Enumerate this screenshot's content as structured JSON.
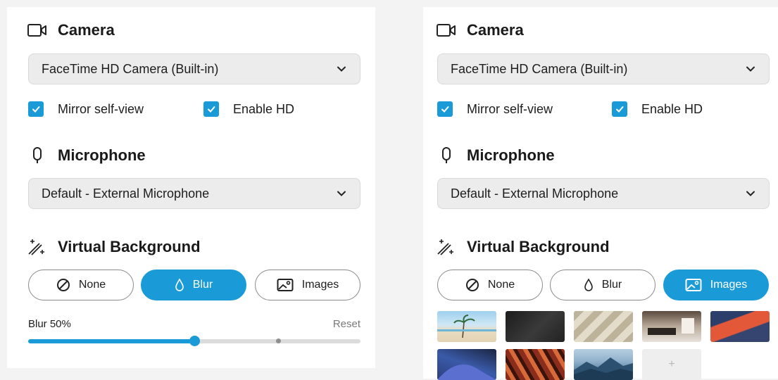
{
  "colors": {
    "accent": "#1a9bd7",
    "field_bg": "#ececec",
    "text": "#1d1d1d"
  },
  "left": {
    "camera": {
      "title": "Camera",
      "icon": "camera-icon",
      "selected": "FaceTime HD Camera (Built-in)",
      "mirror_label": "Mirror self-view",
      "mirror_checked": true,
      "hd_label": "Enable HD",
      "hd_checked": true
    },
    "microphone": {
      "title": "Microphone",
      "icon": "microphone-icon",
      "selected": "Default - External Microphone"
    },
    "virtual_background": {
      "title": "Virtual Background",
      "icon": "magic-wand-icon",
      "options": [
        {
          "label": "None",
          "icon": "none-icon",
          "active": false
        },
        {
          "label": "Blur",
          "icon": "droplet-icon",
          "active": true
        },
        {
          "label": "Images",
          "icon": "image-icon",
          "active": false
        }
      ],
      "blur_label": "Blur 50%",
      "blur_value": 50,
      "reset_label": "Reset"
    }
  },
  "right": {
    "camera": {
      "title": "Camera",
      "icon": "camera-icon",
      "selected": "FaceTime HD Camera (Built-in)",
      "mirror_label": "Mirror self-view",
      "mirror_checked": true,
      "hd_label": "Enable HD",
      "hd_checked": true
    },
    "microphone": {
      "title": "Microphone",
      "icon": "microphone-icon",
      "selected": "Default - External Microphone"
    },
    "virtual_background": {
      "title": "Virtual Background",
      "icon": "magic-wand-icon",
      "options": [
        {
          "label": "None",
          "icon": "none-icon",
          "active": false
        },
        {
          "label": "Blur",
          "icon": "droplet-icon",
          "active": false
        },
        {
          "label": "Images",
          "icon": "image-icon",
          "active": true
        }
      ],
      "add_label": "+"
    }
  }
}
